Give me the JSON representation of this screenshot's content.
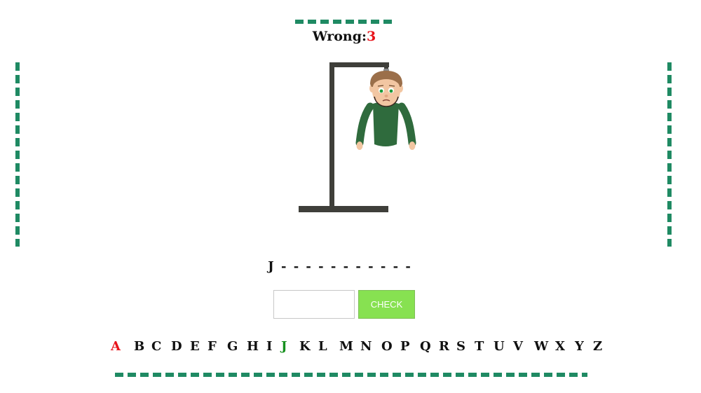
{
  "status": {
    "wrong_label": "Wrong:",
    "wrong_count": "3"
  },
  "word": {
    "display": "J - - - - - - - - - - -"
  },
  "guess": {
    "value": "",
    "placeholder": ""
  },
  "check_button": {
    "label": "CHECK"
  },
  "alphabet": {
    "letters": [
      "A",
      "B",
      "C",
      "D",
      "E",
      "F",
      "G",
      "H",
      "I",
      "J",
      "K",
      "L",
      "M",
      "N",
      "O",
      "P",
      "Q",
      "R",
      "S",
      "T",
      "U",
      "V",
      "W",
      "X",
      "Y",
      "Z"
    ],
    "wrong_guesses": [
      "A"
    ],
    "correct_guesses": [
      "J"
    ]
  },
  "colors": {
    "accent_dash": "#1f8a63",
    "wrong": "#e8131a",
    "correct": "#16901e",
    "button": "#87e151",
    "gallows": "#3f3f3a",
    "shirt": "#2f6b3d"
  },
  "figure": {
    "parts_shown": [
      "head",
      "body",
      "left-arm",
      "right-arm"
    ]
  }
}
